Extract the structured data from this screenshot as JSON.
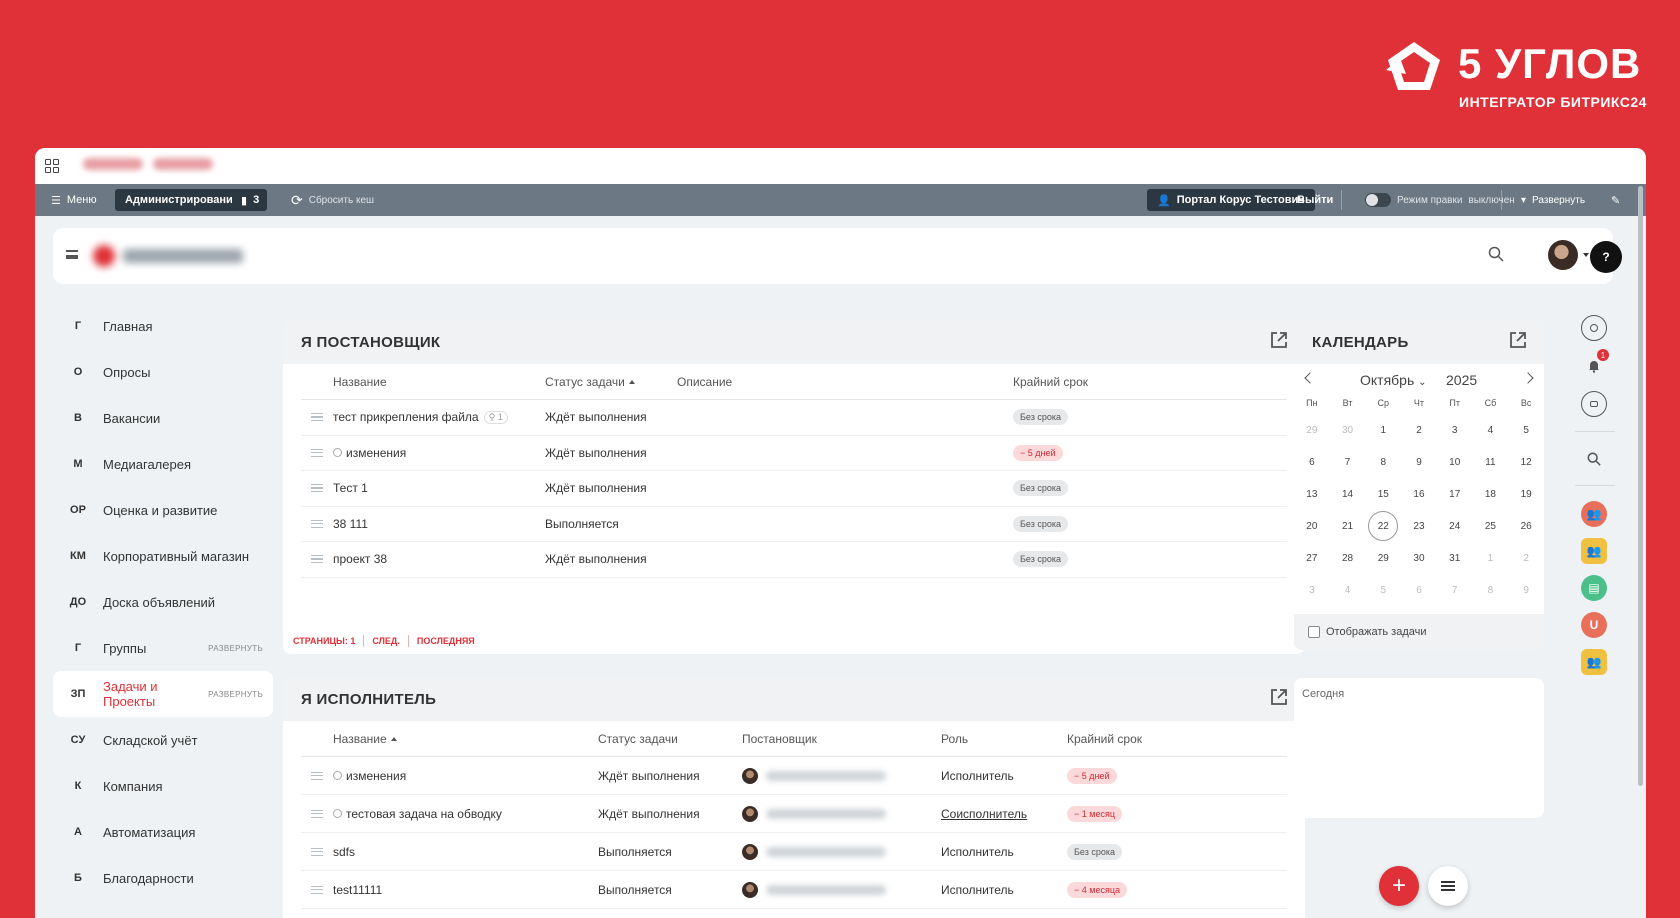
{
  "brand": {
    "title": "5 УГЛОВ",
    "subtitle": "ИНТЕГРАТОР БИТРИКС24",
    "accent": "#e03038"
  },
  "admin_bar": {
    "menu": "Меню",
    "admin": "Администрирование",
    "count": "3",
    "reset_cache": "Сбросить кеш",
    "portal_user": "Портал Корус Тестович",
    "logout": "Выйти",
    "edit_mode": "Режим правки",
    "edit_state": "выключен",
    "expand": "Развернуть"
  },
  "header": {
    "help": "?"
  },
  "sidebar": {
    "expand_label": "РАЗВЕРНУТЬ",
    "items": [
      {
        "abbr": "Г",
        "label": "Главная"
      },
      {
        "abbr": "О",
        "label": "Опросы"
      },
      {
        "abbr": "В",
        "label": "Вакансии"
      },
      {
        "abbr": "М",
        "label": "Медиагалерея"
      },
      {
        "abbr": "ОР",
        "label": "Оценка и развитие"
      },
      {
        "abbr": "КМ",
        "label": "Корпоративный магазин"
      },
      {
        "abbr": "ДО",
        "label": "Доска объявлений"
      },
      {
        "abbr": "Г",
        "label": "Группы"
      },
      {
        "abbr": "ЗП",
        "label": "Задачи и Проекты"
      },
      {
        "abbr": "СУ",
        "label": "Складской учёт"
      },
      {
        "abbr": "К",
        "label": "Компания"
      },
      {
        "abbr": "А",
        "label": "Автоматизация"
      },
      {
        "abbr": "Б",
        "label": "Благодарности"
      }
    ]
  },
  "creator_panel": {
    "title": "Я ПОСТАНОВЩИК",
    "columns": {
      "name": "Название",
      "status": "Статус задачи",
      "description": "Описание",
      "deadline": "Крайний срок"
    },
    "rows": [
      {
        "name": "тест прикрепления файла",
        "clip": "1",
        "status": "Ждёт выполнения",
        "deadline": "Без срока"
      },
      {
        "name": "изменения",
        "status": "Ждёт выполнения",
        "deadline": "− 5 дней"
      },
      {
        "name": "Тест 1",
        "status": "Ждёт выполнения",
        "deadline": "Без срока"
      },
      {
        "name": "38 111",
        "status": "Выполняется",
        "deadline": "Без срока"
      },
      {
        "name": "проект 38",
        "status": "Ждёт выполнения",
        "deadline": "Без срока"
      }
    ],
    "pager": {
      "pages": "СТРАНИЦЫ: 1",
      "next": "СЛЕД.",
      "last": "ПОСЛЕДНЯЯ"
    }
  },
  "executor_panel": {
    "title": "Я ИСПОЛНИТЕЛЬ",
    "columns": {
      "name": "Название",
      "status": "Статус задачи",
      "creator": "Постановщик",
      "role": "Роль",
      "deadline": "Крайний срок"
    },
    "rows": [
      {
        "name": "изменения",
        "status": "Ждёт выполнения",
        "role": "Исполнитель",
        "deadline": "− 5 дней"
      },
      {
        "name": "тестовая задача на обводку",
        "status": "Ждёт выполнения",
        "role": "Соисполнитель",
        "deadline": "− 1 месяц"
      },
      {
        "name": "sdfs",
        "status": "Выполняется",
        "role": "Исполнитель",
        "deadline": "Без срока"
      },
      {
        "name": "test11111",
        "status": "Выполняется",
        "role": "Исполнитель",
        "deadline": "− 4 месяца"
      }
    ]
  },
  "calendar": {
    "title": "КАЛЕНДАРЬ",
    "month": "Октябрь",
    "year": "2025",
    "weekdays": [
      "Пн",
      "Вт",
      "Ср",
      "Чт",
      "Пт",
      "Сб",
      "Вс"
    ],
    "weeks": [
      [
        "29",
        "30",
        "1",
        "2",
        "3",
        "4",
        "5"
      ],
      [
        "6",
        "7",
        "8",
        "9",
        "10",
        "11",
        "12"
      ],
      [
        "13",
        "14",
        "15",
        "16",
        "17",
        "18",
        "19"
      ],
      [
        "20",
        "21",
        "22",
        "23",
        "24",
        "25",
        "26"
      ],
      [
        "27",
        "28",
        "29",
        "30",
        "31",
        "1",
        "2"
      ],
      [
        "3",
        "4",
        "5",
        "6",
        "7",
        "8",
        "9"
      ]
    ],
    "today": "22",
    "show_tasks": "Отображать задачи"
  },
  "today_panel": {
    "title": "Сегодня"
  },
  "rail": {
    "notifications_count": "1",
    "user_initial": "U"
  }
}
